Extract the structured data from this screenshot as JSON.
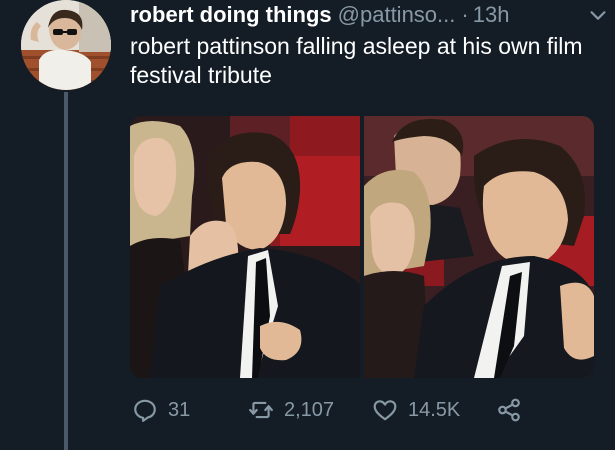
{
  "tweet": {
    "author_name": "robert doing things",
    "author_handle": "@pattinso...",
    "separator": "·",
    "timestamp": "13h",
    "text": "robert pattinson falling asleep at his own film festival tribute",
    "media_count": 2
  },
  "actions": {
    "reply_count": "31",
    "retweet_count": "2,107",
    "like_count": "14.5K"
  },
  "icons": {
    "reply": "reply-icon",
    "retweet": "retweet-icon",
    "like": "heart-icon",
    "share": "share-icon",
    "menu": "chevron-down-icon"
  },
  "colors": {
    "background": "#141d26",
    "secondary_text": "#8899a6",
    "thread_line": "#4b5a6a"
  }
}
